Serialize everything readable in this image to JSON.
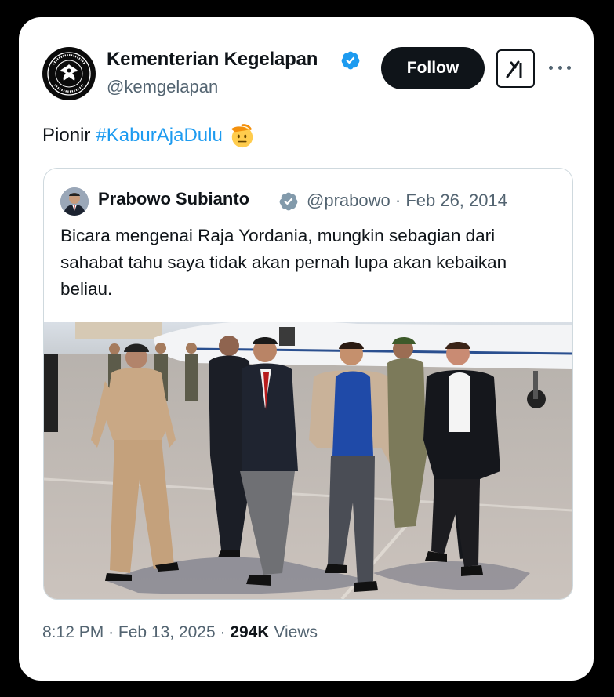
{
  "author": {
    "display_name": "Kementerian Kegelapan",
    "handle": "@kemgelapan",
    "avatar_icon": "kemgelapan-seal-logo",
    "avatar_ring_text": "KEMENTERIAN KEGELAPAN · REPUBLIK INDONESIA",
    "verified_icon": "verified-badge-icon"
  },
  "actions": {
    "follow_label": "Follow",
    "grok_icon": "grok-icon",
    "more_icon": "more-options-icon"
  },
  "tweet": {
    "text": "Pionir",
    "hashtag": "#KaburAjaDulu",
    "emoji": "saluting-face-emoji"
  },
  "quoted_tweet": {
    "display_name": "Prabowo Subianto",
    "handle": "@prabowo",
    "date": "Feb 26, 2014",
    "text": "Bicara mengenai Raja Yordania, mungkin sebagian dari sahabat tahu saya tidak akan pernah lupa akan kebaikan beliau.",
    "badge_icon": "gray-verified-badge-icon",
    "media": "photo-group-walking-on-airport-tarmac"
  },
  "footer": {
    "time": "8:12 PM",
    "date": "Feb 13, 2025",
    "views_count": "294K",
    "views_label": "Views"
  },
  "colors": {
    "text_primary": "#0f1419",
    "text_secondary": "#536471",
    "link_blue": "#1d9bf0",
    "follow_bg": "#0f1419",
    "border": "#cfd9de"
  }
}
